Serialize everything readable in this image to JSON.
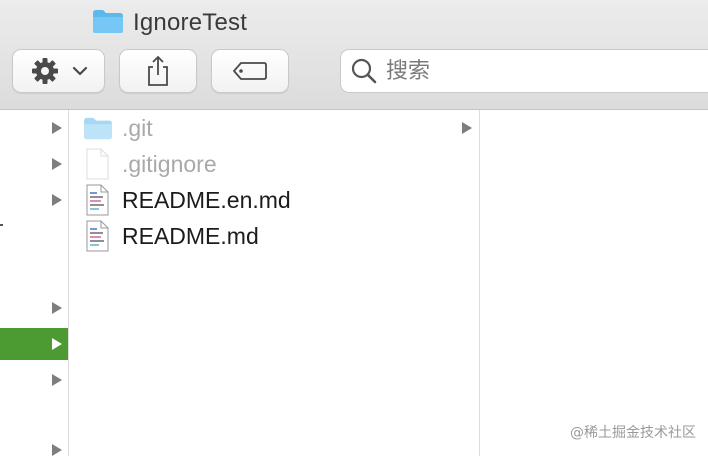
{
  "window": {
    "title": "IgnoreTest",
    "title_icon": "folder-icon"
  },
  "toolbar": {
    "action_button_icon": "gear-icon",
    "action_dropdown_icon": "chevron-down-icon",
    "share_icon": "share-icon",
    "tags_icon": "tag-icon",
    "search": {
      "icon": "search-icon",
      "placeholder": "搜索"
    }
  },
  "column_2": {
    "items": [
      {
        "name": ".git",
        "kind": "folder",
        "hidden": true,
        "icon": "folder-icon"
      },
      {
        "name": ".gitignore",
        "kind": "file",
        "hidden": true,
        "icon": "document-icon"
      },
      {
        "name": "README.en.md",
        "kind": "file",
        "hidden": false,
        "icon": "markdown-file-icon"
      },
      {
        "name": "README.md",
        "kind": "file",
        "hidden": false,
        "icon": "markdown-file-icon"
      }
    ]
  },
  "colors": {
    "selection": "#4c9b32",
    "hidden_text": "#a9a9a9",
    "text": "#1c1c1c"
  },
  "watermark": "@稀土掘金技术社区"
}
